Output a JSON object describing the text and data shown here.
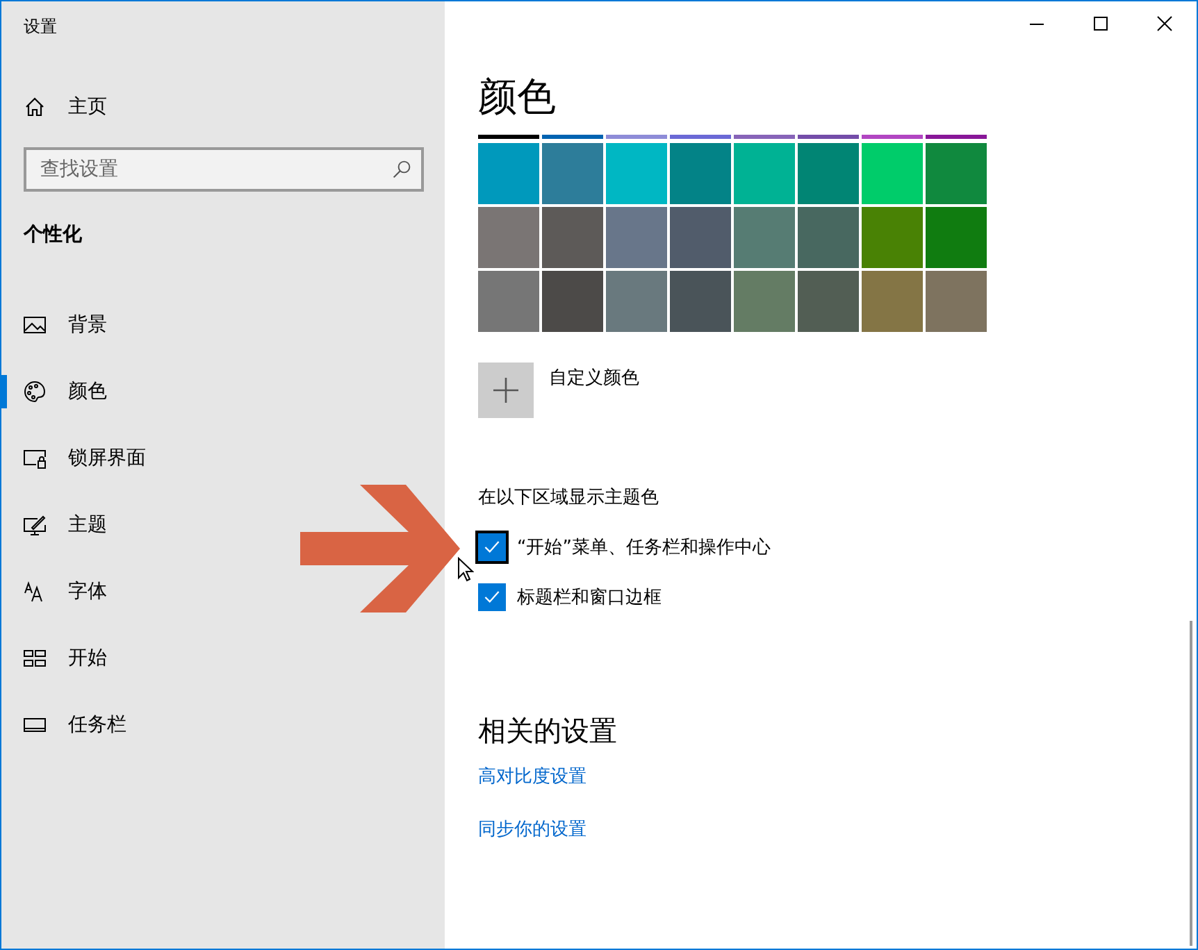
{
  "window": {
    "title": "设置"
  },
  "sidebar": {
    "home": {
      "label": "主页"
    },
    "search": {
      "placeholder": "查找设置"
    },
    "section": "个性化",
    "items": [
      {
        "label": "背景",
        "kind": "picture",
        "selected": false
      },
      {
        "label": "颜色",
        "kind": "palette",
        "selected": true
      },
      {
        "label": "锁屏界面",
        "kind": "lockscreen",
        "selected": false
      },
      {
        "label": "主题",
        "kind": "theme",
        "selected": false
      },
      {
        "label": "字体",
        "kind": "font",
        "selected": false
      },
      {
        "label": "开始",
        "kind": "start",
        "selected": false
      },
      {
        "label": "任务栏",
        "kind": "taskbar",
        "selected": false
      }
    ]
  },
  "main": {
    "title": "颜色",
    "swatch_strip": [
      {
        "color": "#000000"
      },
      {
        "color": "#0063b1"
      },
      {
        "color": "#8e8cd8"
      },
      {
        "color": "#6b69d6"
      },
      {
        "color": "#8764b8"
      },
      {
        "color": "#744da9"
      },
      {
        "color": "#b146c2"
      },
      {
        "color": "#881798"
      }
    ],
    "swatch_rows": [
      [
        {
          "color": "#0099bc"
        },
        {
          "color": "#2d7d9a"
        },
        {
          "color": "#00b7c3"
        },
        {
          "color": "#038387"
        },
        {
          "color": "#00b294"
        },
        {
          "color": "#018574"
        },
        {
          "color": "#00cc6a"
        },
        {
          "color": "#10893e"
        }
      ],
      [
        {
          "color": "#7a7574"
        },
        {
          "color": "#5d5a58"
        },
        {
          "color": "#68768a"
        },
        {
          "color": "#515c6b"
        },
        {
          "color": "#567c73"
        },
        {
          "color": "#486860"
        },
        {
          "color": "#498205"
        },
        {
          "color": "#107c10"
        }
      ],
      [
        {
          "color": "#767676"
        },
        {
          "color": "#4c4a48"
        },
        {
          "color": "#69797e"
        },
        {
          "color": "#4a5459"
        },
        {
          "color": "#647c64"
        },
        {
          "color": "#525e54"
        },
        {
          "color": "#847545"
        },
        {
          "color": "#7e735f"
        }
      ]
    ],
    "custom_color": {
      "label": "自定义颜色"
    },
    "accent_label": "在以下区域显示主题色",
    "checkboxes": [
      {
        "label": "“开始”菜单、任务栏和操作中心",
        "checked": true,
        "focused": true
      },
      {
        "label": "标题栏和窗口边框",
        "checked": true,
        "focused": false
      }
    ],
    "related": {
      "heading": "相关的设置",
      "links": [
        "高对比度设置",
        "同步你的设置"
      ]
    }
  }
}
